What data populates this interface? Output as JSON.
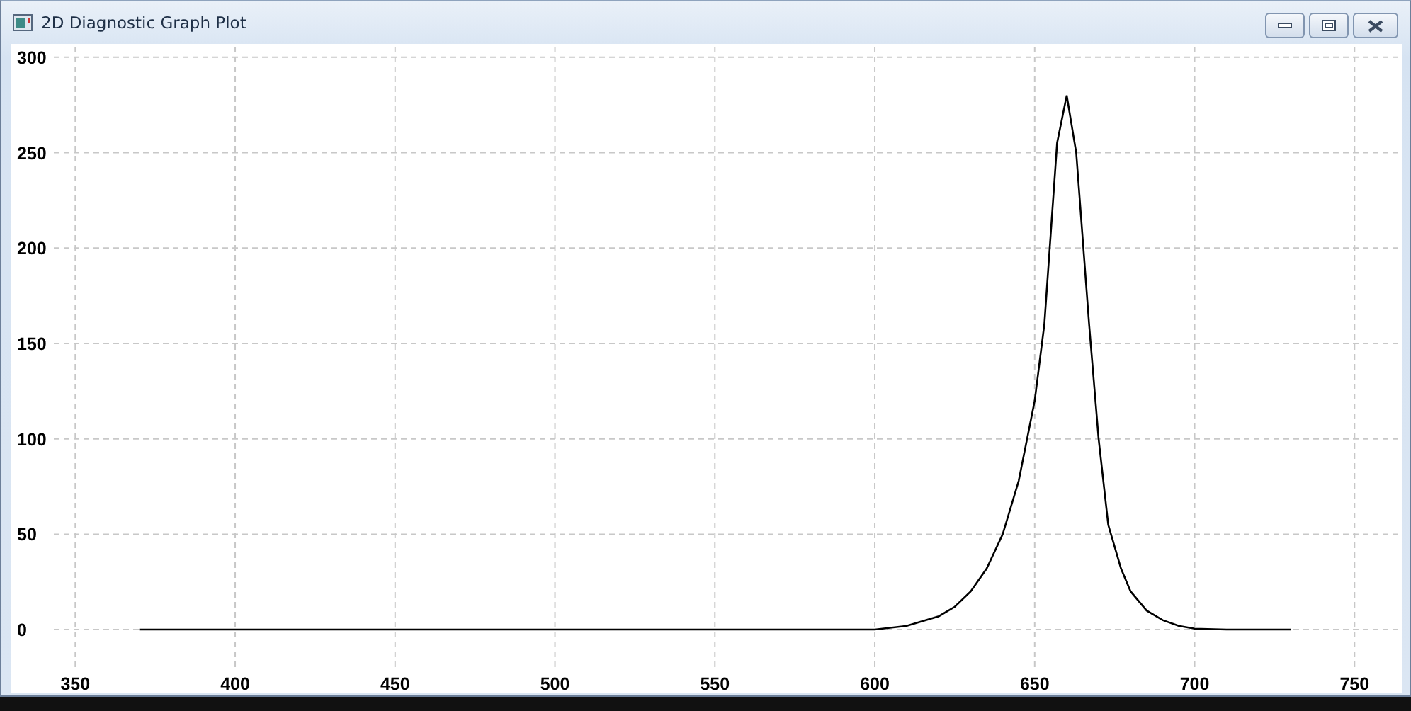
{
  "window": {
    "title": "2D Diagnostic Graph Plot"
  },
  "plot": {
    "chart_data": {
      "type": "line",
      "x": [
        370,
        600,
        610,
        620,
        625,
        630,
        635,
        640,
        645,
        650,
        653,
        657,
        660,
        663,
        667,
        670,
        673,
        677,
        680,
        685,
        690,
        695,
        700,
        710,
        730
      ],
      "series": [
        {
          "color": "#000000",
          "values": [
            0,
            0,
            2,
            7,
            12,
            20,
            32,
            50,
            78,
            120,
            160,
            255,
            280,
            250,
            160,
            100,
            55,
            32,
            20,
            10,
            5,
            2,
            0.5,
            0,
            0
          ]
        }
      ],
      "xticks": [
        350,
        400,
        450,
        500,
        550,
        600,
        650,
        700,
        750
      ],
      "yticks": [
        0,
        50,
        100,
        150,
        200,
        250,
        300
      ],
      "xlim": [
        330,
        765
      ],
      "ylim": [
        -33,
        307
      ],
      "grid": true
    }
  }
}
